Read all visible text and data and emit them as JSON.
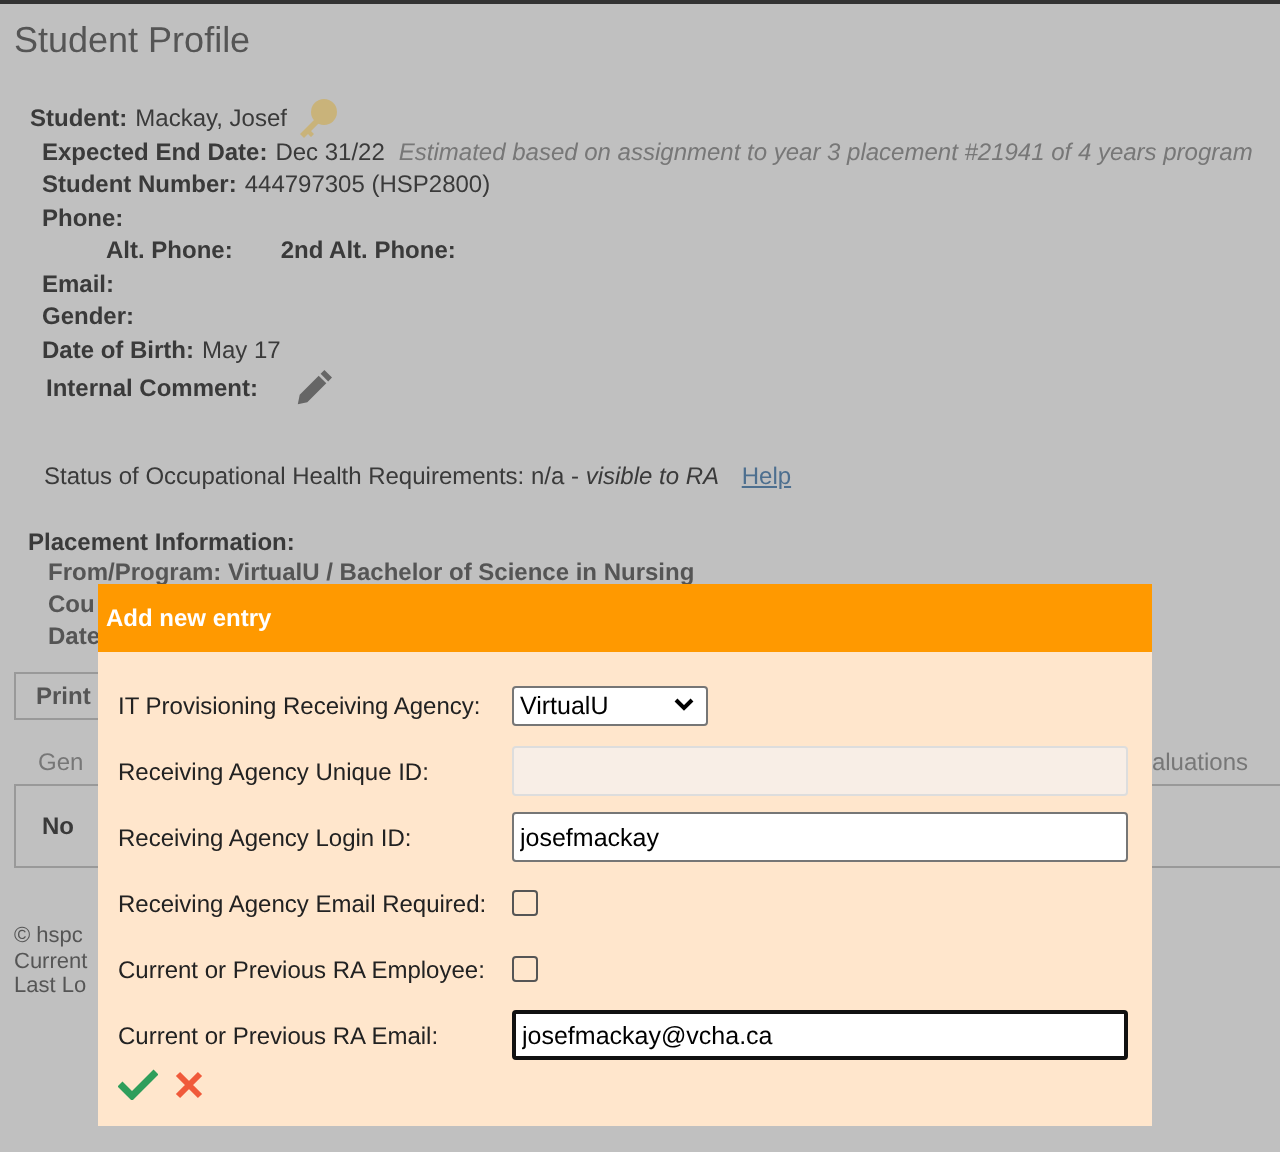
{
  "page": {
    "title": "Student Profile"
  },
  "student": [
    {
      "kind": "key",
      "label": "Student:",
      "value": "Mackay, Josef"
    },
    {
      "kind": "note",
      "label": "Expected End Date:",
      "value": "Dec 31/22",
      "note": "Estimated based on assignment to year 3 placement #21941 of 4 years program"
    },
    {
      "kind": "plain",
      "label": "Student Number:",
      "value": "444797305  (HSP2800)"
    },
    {
      "kind": "plain",
      "label": "Phone:"
    },
    {
      "kind": "pair",
      "label": "Alt. Phone:",
      "label_2": "2nd Alt. Phone:"
    },
    {
      "kind": "plain",
      "label": "Email:"
    },
    {
      "kind": "plain",
      "label": "Gender:"
    },
    {
      "kind": "plain",
      "label": "Date of Birth:",
      "value": "May 17"
    },
    {
      "kind": "edit",
      "label": "Internal Comment:"
    }
  ],
  "status": {
    "text": "Status of Occupational Health Requirements: n/a - *visible to RA*",
    "link": "Help"
  },
  "placement": {
    "heading": "Placement Information:",
    "lines": [
      "From/Program: VirtualU / Bachelor of Science in Nursing",
      "Cou",
      "Date"
    ]
  },
  "print_button": "Print",
  "tabs": [
    {
      "label": "Gen",
      "selected": false
    },
    {
      "label": "aluations",
      "selected": false
    }
  ],
  "panel_text": "No",
  "footer": [
    "© hspc",
    "Current",
    "Last Lo"
  ],
  "dialog": {
    "title": "Add new entry",
    "fields": [
      {
        "kind": "select",
        "label": "IT Provisioning Receiving Agency:",
        "value": "VirtualU"
      },
      {
        "kind": "text",
        "label": "Receiving Agency Unique ID:",
        "disabled": true
      },
      {
        "kind": "text",
        "label": "Receiving Agency Login ID:",
        "value": "josefmackay"
      },
      {
        "kind": "checkbox",
        "label": "Receiving Agency Email Required:",
        "checked": false
      },
      {
        "kind": "checkbox",
        "label": "Current or Previous RA Employee:",
        "checked": false
      },
      {
        "kind": "text",
        "label": "Current or Previous RA Email:",
        "value": "josefmackay@vcha.ca",
        "focused": true
      }
    ]
  }
}
